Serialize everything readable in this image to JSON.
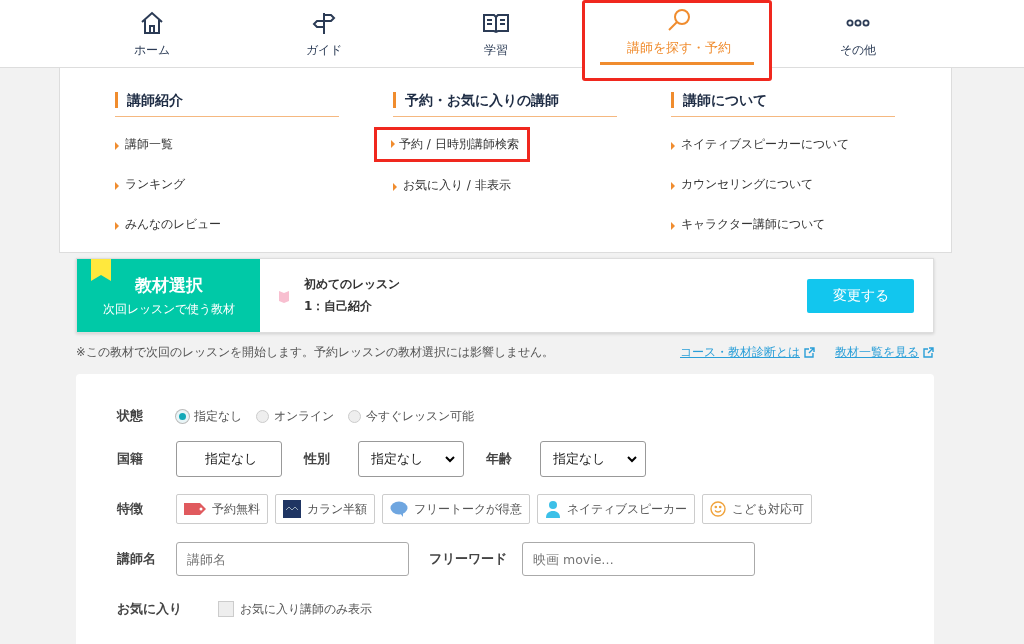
{
  "nav": [
    {
      "label": "ホーム",
      "selected": false,
      "highlighted": false
    },
    {
      "label": "ガイド",
      "selected": false,
      "highlighted": false
    },
    {
      "label": "学習",
      "selected": false,
      "highlighted": false
    },
    {
      "label": "講師を探す・予約",
      "selected": true,
      "highlighted": true
    },
    {
      "label": "その他",
      "selected": false,
      "highlighted": false
    }
  ],
  "menu": [
    {
      "heading": "講師紹介",
      "links": [
        {
          "label": "講師一覧",
          "highlighted": false
        },
        {
          "label": "ランキング",
          "highlighted": false
        },
        {
          "label": "みんなのレビュー",
          "highlighted": false
        }
      ]
    },
    {
      "heading": "予約・お気に入りの講師",
      "links": [
        {
          "label": "予約 / 日時別講師検索",
          "highlighted": true
        },
        {
          "label": "お気に入り / 非表示",
          "highlighted": false
        }
      ]
    },
    {
      "heading": "講師について",
      "links": [
        {
          "label": "ネイティブスピーカーについて",
          "highlighted": false
        },
        {
          "label": "カウンセリングについて",
          "highlighted": false
        },
        {
          "label": "キャラクター講師について",
          "highlighted": false
        }
      ]
    }
  ],
  "material": {
    "title": "教材選択",
    "subtitle": "次回レッスンで使う教材",
    "course": "初めてのレッスン",
    "lesson": "1：自己紹介",
    "button": "変更する"
  },
  "note": "※この教材で次回のレッスンを開始します。予約レッスンの教材選択には影響しません。",
  "links": [
    "コース・教材診断とは",
    "教材一覧を見る"
  ],
  "search": {
    "status": {
      "label": "状態",
      "options": [
        {
          "label": "指定なし",
          "selected": true
        },
        {
          "label": "オンライン",
          "selected": false
        },
        {
          "label": "今すぐレッスン可能",
          "selected": false
        }
      ]
    },
    "selects": [
      {
        "label": "国籍",
        "value": "指定なし",
        "kind": "button"
      },
      {
        "label": "性別",
        "value": "指定なし",
        "kind": "select"
      },
      {
        "label": "年齢",
        "value": "指定なし",
        "kind": "select"
      }
    ],
    "features": {
      "label": "特徴",
      "chips": [
        {
          "label": "予約無料",
          "kind": "tag"
        },
        {
          "label": "カラン半額",
          "kind": "callan"
        },
        {
          "label": "フリートークが得意",
          "kind": "bubble"
        },
        {
          "label": "ネイティブスピーカー",
          "kind": "person"
        },
        {
          "label": "こども対応可",
          "kind": "smile"
        }
      ]
    },
    "name": {
      "label": "講師名",
      "placeholder": "講師名"
    },
    "freeword": {
      "label": "フリーワード",
      "placeholder": "映画 movie…"
    },
    "favorite": {
      "label": "お気に入り",
      "option": "お気に入り講師のみ表示",
      "checked": false
    }
  }
}
